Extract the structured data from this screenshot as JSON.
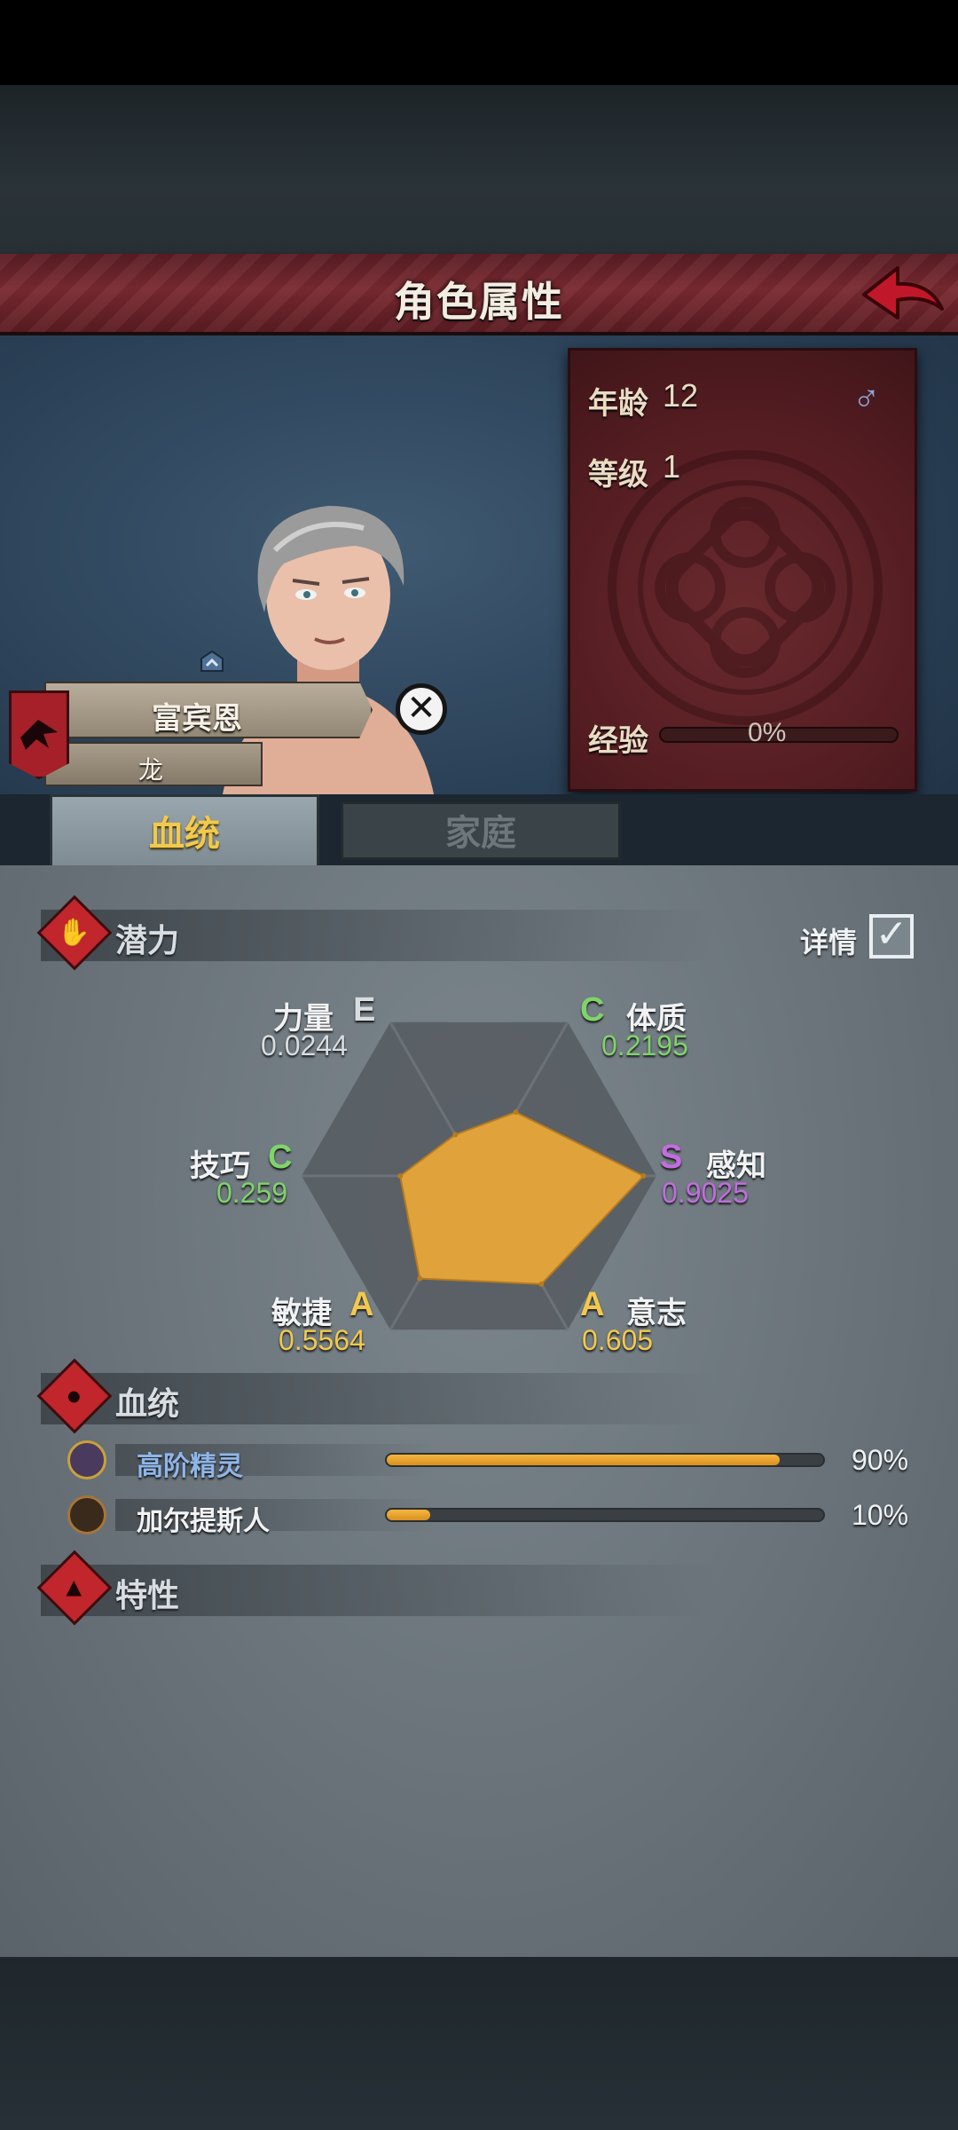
{
  "header": {
    "title": "角色属性"
  },
  "info": {
    "age_label": "年龄",
    "age_value": "12",
    "level_label": "等级",
    "level_value": "1",
    "exp_label": "经验",
    "exp_value": "0%",
    "gender_symbol": "♂"
  },
  "character": {
    "name": "富宾恩",
    "title": "龙",
    "close_symbol": "✕"
  },
  "tabs": [
    {
      "label": "血统",
      "active": true
    },
    {
      "label": "家庭",
      "active": false
    }
  ],
  "potential": {
    "title": "潜力",
    "details_label": "详情",
    "details_checked": true,
    "check_symbol": "✓",
    "stats": [
      {
        "name": "力量",
        "grade": "E",
        "value": "0.0244",
        "v": 0.0244
      },
      {
        "name": "体质",
        "grade": "C",
        "value": "0.2195",
        "v": 0.2195
      },
      {
        "name": "感知",
        "grade": "S",
        "value": "0.9025",
        "v": 0.9025
      },
      {
        "name": "意志",
        "grade": "A",
        "value": "0.605",
        "v": 0.605
      },
      {
        "name": "敏捷",
        "grade": "A",
        "value": "0.5564",
        "v": 0.5564
      },
      {
        "name": "技巧",
        "grade": "C",
        "value": "0.259",
        "v": 0.259
      }
    ]
  },
  "chart_data": {
    "type": "radar",
    "categories": [
      "力量",
      "体质",
      "感知",
      "意志",
      "敏捷",
      "技巧"
    ],
    "values": [
      0.0244,
      0.2195,
      0.9025,
      0.605,
      0.5564,
      0.259
    ],
    "ylim": [
      0,
      1
    ]
  },
  "bloodline": {
    "title": "血统",
    "items": [
      {
        "name": "高阶精灵",
        "percent_text": "90%",
        "fraction": 0.9
      },
      {
        "name": "加尔提斯人",
        "percent_text": "10%",
        "fraction": 0.1
      }
    ]
  },
  "traits": {
    "title": "特性"
  },
  "colors": {
    "grade_E": "#d8dde2",
    "grade_C": "#7fd36a",
    "grade_S": "#c26de0",
    "grade_A": "#f2c94c",
    "radar_fill": "#e0a23a",
    "blood_elf": "#8fb6e8",
    "blood_other": "#f0f2f4"
  }
}
